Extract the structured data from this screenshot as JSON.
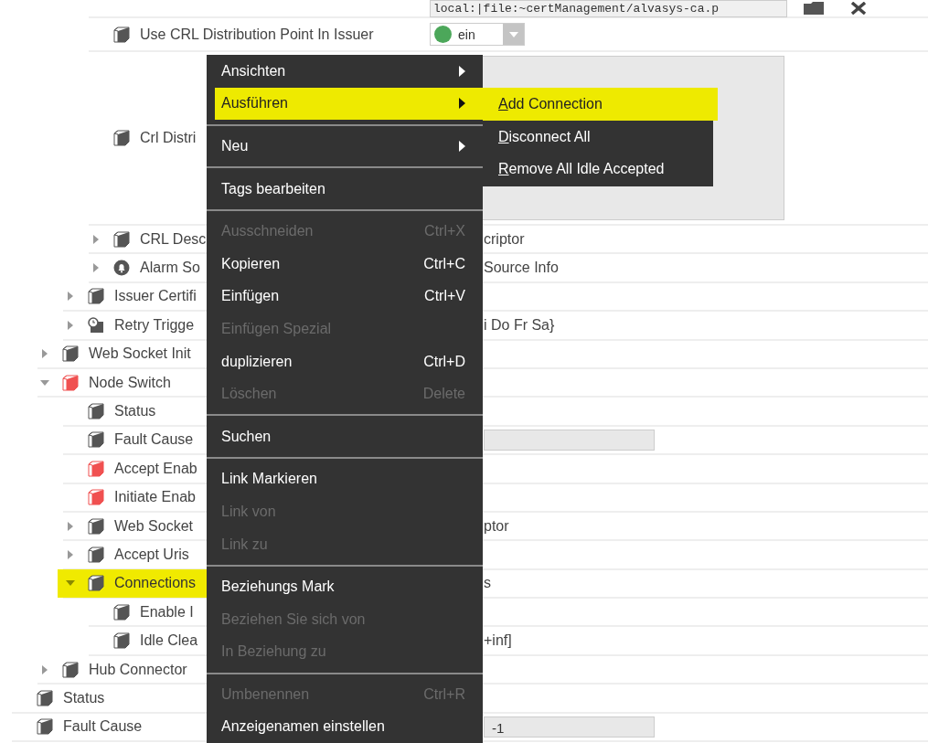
{
  "tree": {
    "children": [
      {
        "children": [
          {
            "children": [
              {
                "children": [
                  {
                    "value": {
                      "kind": "file-field",
                      "text": "local:|file:~certManagement/alvasys-ca.p"
                    }
                  },
                  {
                    "label": "Use CRL Distribution Point In Issuer",
                    "kind": "cube",
                    "selected": false,
                    "value": {
                      "kind": "dropdown",
                      "text": "ein"
                    }
                  },
                  {
                    "label": "Crl Distri",
                    "kind": "cube",
                    "selected": false,
                    "value": {
                      "kind": "textarea"
                    }
                  },
                  {
                    "label": "CRL Desc",
                    "kind": "cube",
                    "selected": false,
                    "expanded": false,
                    "value": {
                      "kind": "text",
                      "text": "criptor"
                    }
                  },
                  {
                    "label": "Alarm So",
                    "kind": "bell",
                    "selected": false,
                    "expanded": false,
                    "value": {
                      "kind": "text",
                      "text": "Source Info"
                    }
                  }
                ]
              },
              {
                "label": "Issuer Certifi",
                "kind": "cube",
                "selected": false,
                "expanded": false
              },
              {
                "label": "Retry Trigge",
                "kind": "timer",
                "selected": false,
                "expanded": false,
                "value": {
                  "kind": "text",
                  "text": "i Do Fr Sa}"
                }
              }
            ]
          },
          {
            "label": "Web Socket Init",
            "kind": "cube",
            "selected": false,
            "expanded": false
          },
          {
            "label": "Node Switch",
            "kind": "cube-red",
            "selected": false,
            "expanded": true,
            "children": [
              {
                "label": "Status",
                "kind": "cube",
                "selected": false
              },
              {
                "label": "Fault Cause",
                "kind": "cube",
                "selected": false,
                "value": {
                  "kind": "field"
                }
              },
              {
                "label": "Accept Enab",
                "kind": "cube-red",
                "selected": false
              },
              {
                "label": "Initiate Enab",
                "kind": "cube-red",
                "selected": false
              },
              {
                "label": "Web Socket",
                "kind": "cube",
                "selected": false,
                "expanded": false,
                "value": {
                  "kind": "text",
                  "text": "ptor"
                }
              },
              {
                "label": "Accept Uris",
                "kind": "cube",
                "selected": false,
                "expanded": false
              },
              {
                "label": "Connections",
                "kind": "cube",
                "selected": true,
                "expanded": true,
                "value": {
                  "kind": "text",
                  "text": "s"
                },
                "children": [
                  {
                    "label": "Enable I",
                    "kind": "cube",
                    "selected": false
                  },
                  {
                    "label": "Idle Clea",
                    "kind": "cube",
                    "selected": false,
                    "value": {
                      "kind": "text",
                      "text": "+inf]"
                    }
                  }
                ]
              }
            ]
          },
          {
            "label": "Hub Connector",
            "kind": "cube",
            "selected": false,
            "expanded": false
          }
        ]
      },
      {
        "label": "Status",
        "kind": "cube",
        "selected": false
      },
      {
        "label": "Fault Cause",
        "kind": "cube",
        "selected": false,
        "value": {
          "kind": "field",
          "text": "-1"
        }
      }
    ]
  },
  "context_menu": {
    "items": [
      {
        "kind": "item",
        "label": "Ansichten",
        "submenu": true,
        "selected": false,
        "disabled": false
      },
      {
        "kind": "item",
        "label": "Ausführen",
        "submenu": true,
        "selected": true,
        "disabled": false
      },
      {
        "kind": "separator"
      },
      {
        "kind": "item",
        "label": "Neu",
        "submenu": true,
        "selected": false,
        "disabled": false
      },
      {
        "kind": "separator"
      },
      {
        "kind": "item",
        "label": "Tags bearbeiten",
        "selected": false,
        "disabled": false
      },
      {
        "kind": "separator"
      },
      {
        "kind": "item",
        "label": "Ausschneiden",
        "shortcut": "Ctrl+X",
        "selected": false,
        "disabled": true
      },
      {
        "kind": "item",
        "label": "Kopieren",
        "shortcut": "Ctrl+C",
        "selected": false,
        "disabled": false
      },
      {
        "kind": "item",
        "label": "Einfügen",
        "shortcut": "Ctrl+V",
        "selected": false,
        "disabled": false
      },
      {
        "kind": "item",
        "label": "Einfügen Spezial",
        "selected": false,
        "disabled": true
      },
      {
        "kind": "item",
        "label": "duplizieren",
        "shortcut": "Ctrl+D",
        "selected": false,
        "disabled": false
      },
      {
        "kind": "item",
        "label": "Löschen",
        "shortcut": "Delete",
        "selected": false,
        "disabled": true
      },
      {
        "kind": "separator"
      },
      {
        "kind": "item",
        "label": "Suchen",
        "selected": false,
        "disabled": false
      },
      {
        "kind": "separator"
      },
      {
        "kind": "item",
        "label": "Link Markieren",
        "selected": false,
        "disabled": false
      },
      {
        "kind": "item",
        "label": "Link von",
        "selected": false,
        "disabled": true
      },
      {
        "kind": "item",
        "label": "Link zu",
        "selected": false,
        "disabled": true
      },
      {
        "kind": "separator"
      },
      {
        "kind": "item",
        "label": "Beziehungs Mark",
        "selected": false,
        "disabled": false
      },
      {
        "kind": "item",
        "label": "Beziehen Sie sich von",
        "selected": false,
        "disabled": true
      },
      {
        "kind": "item",
        "label": "In Beziehung zu",
        "selected": false,
        "disabled": true
      },
      {
        "kind": "separator"
      },
      {
        "kind": "item",
        "label": "Umbenennen",
        "shortcut": "Ctrl+R",
        "selected": false,
        "disabled": true
      },
      {
        "kind": "item",
        "label": "Anzeigenamen einstellen",
        "selected": false,
        "disabled": false
      }
    ]
  },
  "submenu": {
    "items": [
      {
        "label": "Add Connection",
        "selected": true
      },
      {
        "label": "Disconnect All",
        "selected": false
      },
      {
        "label": "Remove All Idle Accepted",
        "selected": false
      }
    ]
  }
}
